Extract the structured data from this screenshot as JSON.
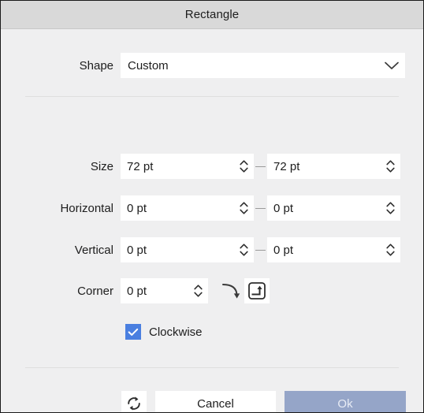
{
  "window": {
    "title": "Rectangle"
  },
  "colors": {
    "titlebar_bg": "#d9d9d9",
    "body_bg": "#efeff0",
    "field_bg": "#ffffff",
    "checkbox_accent": "#4a7fe0",
    "ok_button_bg": "#95a5c8",
    "ok_button_text": "#e8ecf5",
    "divider": "#dedede",
    "text": "#1d1d1d"
  },
  "shape": {
    "label": "Shape",
    "value": "Custom",
    "chevron_icon": "chevron-down-icon"
  },
  "rows": {
    "size": {
      "label": "Size",
      "left_value": "72 pt",
      "right_value": "72 pt",
      "separator": "—",
      "spinner_icon": "spinner-updown-icon"
    },
    "horizontal": {
      "label": "Horizontal",
      "left_value": "0 pt",
      "right_value": "0 pt",
      "separator": "—",
      "spinner_icon": "spinner-updown-icon"
    },
    "vertical": {
      "label": "Vertical",
      "left_value": "0 pt",
      "right_value": "0 pt",
      "separator": "—",
      "spinner_icon": "spinner-updown-icon"
    },
    "corner": {
      "label": "Corner",
      "value": "0 pt",
      "spinner_icon": "spinner-updown-icon",
      "rounded_corner_icon": "rounded-corner-icon",
      "square_corner_icon": "square-corner-icon"
    }
  },
  "clockwise": {
    "label": "Clockwise",
    "checked": true,
    "check_icon": "checkmark-icon"
  },
  "footer": {
    "reset_icon": "reset-refresh-icon",
    "cancel_label": "Cancel",
    "ok_label": "Ok"
  }
}
